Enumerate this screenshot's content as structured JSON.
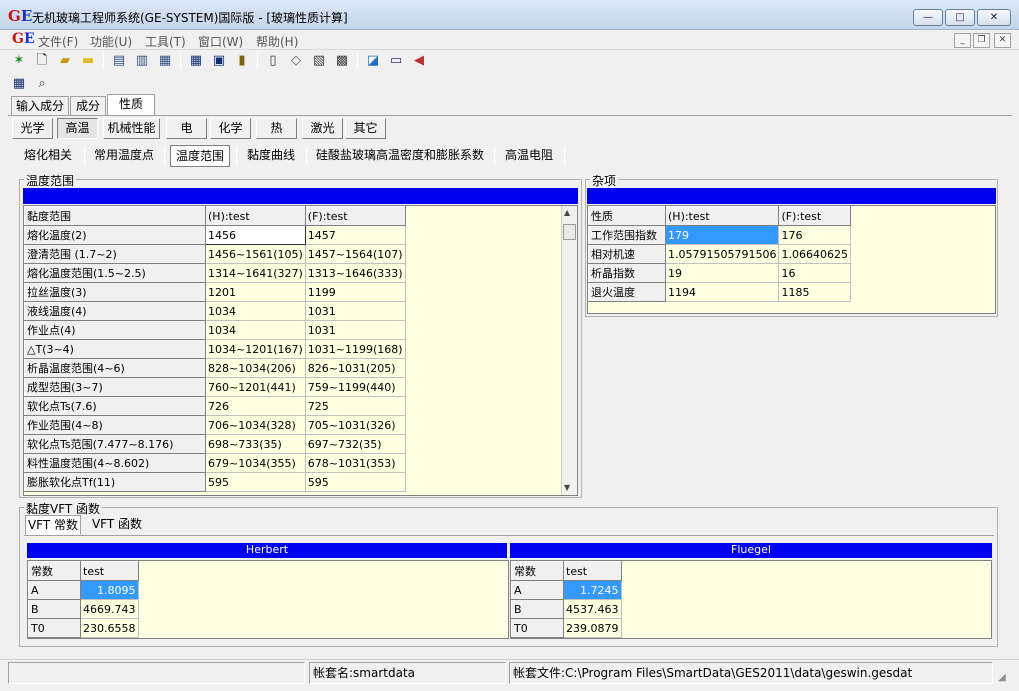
{
  "window": {
    "title": "无机玻璃工程师系统(GE-SYSTEM)国际版 - [玻璃性质计算]",
    "logo_g": "G",
    "logo_e": "E",
    "minimize": "—",
    "maximize": "□",
    "close": "✕"
  },
  "menu": {
    "items": [
      "文件(F)",
      "功能(U)",
      "工具(T)",
      "窗口(W)",
      "帮助(H)"
    ],
    "mdi_min": "_",
    "mdi_restore": "❐",
    "mdi_close": "✕"
  },
  "toolbar": {
    "icons": [
      "run-icon",
      "new-file-icon",
      "open-folder-icon",
      "folder-icon",
      "document-search-icon",
      "document-copy-icon",
      "document-edit-icon",
      "table-icon",
      "form-icon",
      "database-icon",
      "calculator-icon",
      "eraser-icon",
      "edit-sheet-icon",
      "printer-icon",
      "book-icon",
      "keyboard-icon",
      "speaker-icon",
      "grid-icon",
      "print-preview-icon"
    ]
  },
  "top_tabs": [
    "输入成分",
    "成分",
    "性质"
  ],
  "prop_tabs": [
    "光学",
    "高温",
    "机械性能",
    "电",
    "化学",
    "热",
    "激光",
    "其它"
  ],
  "sub_tabs": [
    "熔化相关",
    "常用温度点",
    "温度范围",
    "黏度曲线",
    "硅酸盐玻璃高温密度和膨胀系数",
    "高温电阻"
  ],
  "temp_range": {
    "group_label": "温度范围",
    "headers": [
      "黏度范围",
      "(H):test",
      "(F):test"
    ],
    "rows": [
      [
        "熔化温度(2)",
        "1456",
        "1457"
      ],
      [
        "澄清范围  (1.7~2)",
        "1456~1561(105)",
        "1457~1564(107)"
      ],
      [
        "熔化温度范围(1.5~2.5)",
        "1314~1641(327)",
        "1313~1646(333)"
      ],
      [
        "拉丝温度(3)",
        "1201",
        "1199"
      ],
      [
        "液线温度(4)",
        "1034",
        "1031"
      ],
      [
        "作业点(4)",
        "1034",
        "1031"
      ],
      [
        "△T(3~4)",
        "1034~1201(167)",
        "1031~1199(168)"
      ],
      [
        "析晶温度范围(4~6)",
        "828~1034(206)",
        "826~1031(205)"
      ],
      [
        "成型范围(3~7)",
        "760~1201(441)",
        "759~1199(440)"
      ],
      [
        "软化点Ts(7.6)",
        "726",
        "725"
      ],
      [
        "作业范围(4~8)",
        "706~1034(328)",
        "705~1031(326)"
      ],
      [
        "软化点Ts范围(7.477~8.176)",
        "698~733(35)",
        "697~732(35)"
      ],
      [
        "料性温度范围(4~8.602)",
        "679~1034(355)",
        "678~1031(353)"
      ],
      [
        "膨胀软化点Tf(11)",
        "595",
        "595"
      ]
    ]
  },
  "misc": {
    "group_label": "杂项",
    "headers": [
      "性质",
      "(H):test",
      "(F):test"
    ],
    "rows": [
      [
        "工作范围指数",
        "179",
        "176"
      ],
      [
        "相对机速",
        "1.05791505791506",
        "1.06640625"
      ],
      [
        "析晶指数",
        "19",
        "16"
      ],
      [
        "退火温度",
        "1194",
        "1185"
      ]
    ]
  },
  "vft": {
    "group_label": "黏度VFT 函数",
    "tabs": [
      "VFT 常数",
      "VFT 函数"
    ],
    "herbert": {
      "title": "Herbert",
      "headers": [
        "常数",
        "test"
      ],
      "rows": [
        [
          "A",
          "1.8095"
        ],
        [
          "B",
          "4669.743"
        ],
        [
          "T0",
          "230.6558"
        ]
      ]
    },
    "fluegel": {
      "title": "Fluegel",
      "headers": [
        "常数",
        "test"
      ],
      "rows": [
        [
          "A",
          "1.7245"
        ],
        [
          "B",
          "4537.463"
        ],
        [
          "T0",
          "239.0879"
        ]
      ]
    }
  },
  "status": {
    "account_name": "帐套名:smartdata",
    "account_file": "帐套文件:C:\\Program Files\\SmartData\\GES2011\\data\\geswin.gesdat"
  },
  "colors": {
    "grid_bg": "#ffffe1",
    "header_bar": "#0000f0",
    "selection": "#3399ff"
  }
}
